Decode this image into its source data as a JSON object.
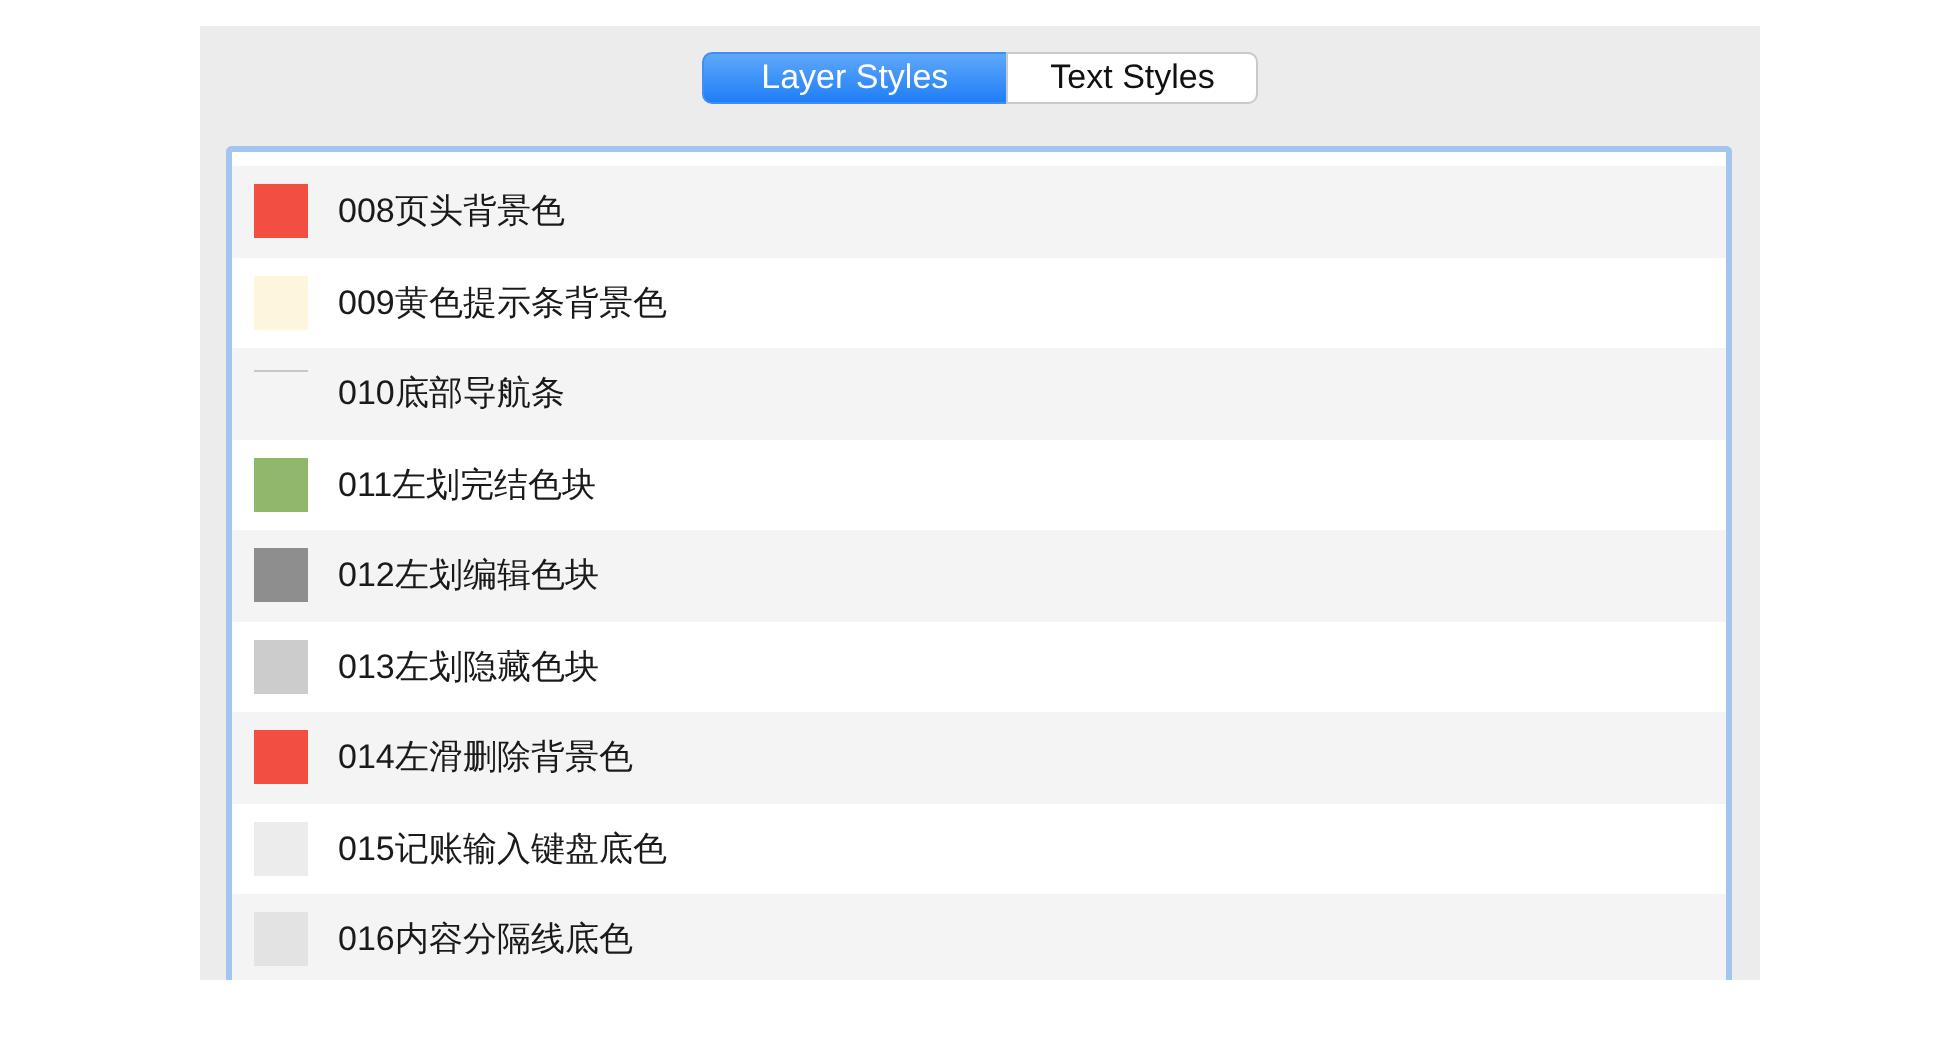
{
  "tabs": [
    {
      "label": "Layer Styles",
      "selected": true
    },
    {
      "label": "Text Styles",
      "selected": false
    }
  ],
  "styles": [
    {
      "name": "008页头背景色",
      "kind": "swatch",
      "color": "#f24e42"
    },
    {
      "name": "009黄色提示条背景色",
      "kind": "swatch",
      "color": "#fdf6dc"
    },
    {
      "name": "010底部导航条",
      "kind": "line",
      "color": "#c8c8c8"
    },
    {
      "name": "011左划完结色块",
      "kind": "swatch",
      "color": "#8fb86a"
    },
    {
      "name": "012左划编辑色块",
      "kind": "swatch",
      "color": "#8e8e8e"
    },
    {
      "name": "013左划隐藏色块",
      "kind": "swatch",
      "color": "#cccccc"
    },
    {
      "name": "014左滑删除背景色",
      "kind": "swatch",
      "color": "#f24e42"
    },
    {
      "name": "015记账输入键盘底色",
      "kind": "swatch",
      "color": "#ececec"
    },
    {
      "name": "016内容分隔线底色",
      "kind": "swatch",
      "color": "#e3e3e3"
    }
  ]
}
